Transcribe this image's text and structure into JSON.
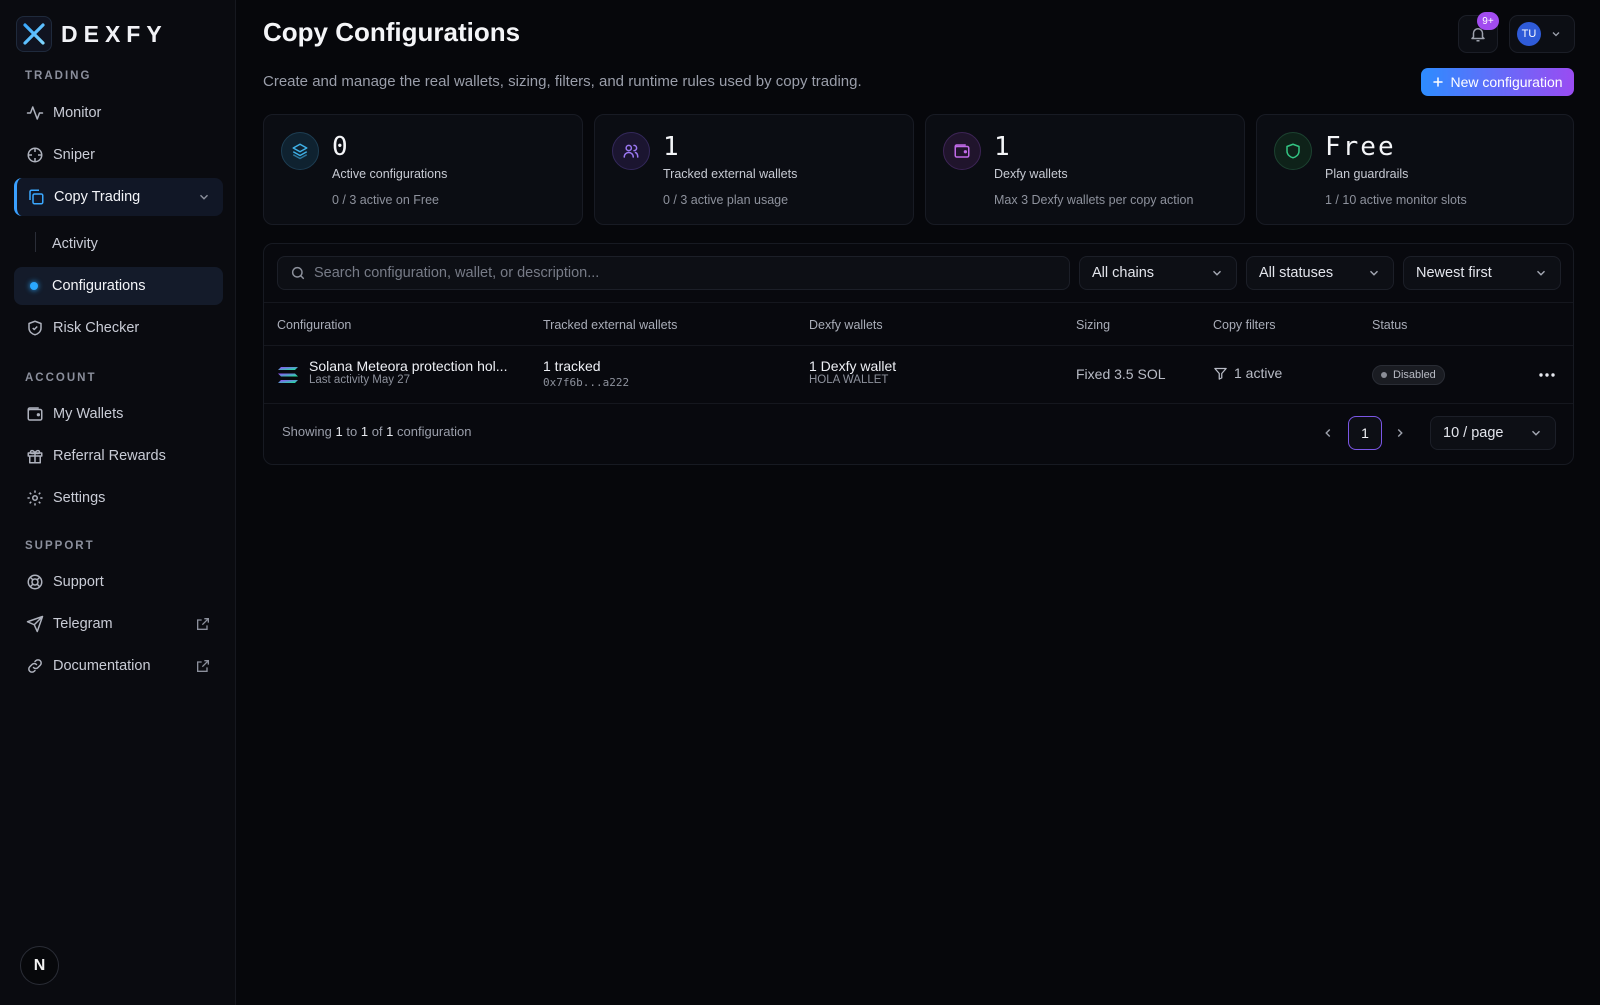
{
  "brand": {
    "name": "DEXFY"
  },
  "sidebar": {
    "trading_label": "TRADING",
    "account_label": "ACCOUNT",
    "support_label": "SUPPORT",
    "monitor": "Monitor",
    "sniper": "Sniper",
    "copy_trading": "Copy Trading",
    "activity": "Activity",
    "configurations": "Configurations",
    "risk_checker": "Risk Checker",
    "my_wallets": "My Wallets",
    "referral_rewards": "Referral Rewards",
    "settings": "Settings",
    "support": "Support",
    "telegram": "Telegram",
    "documentation": "Documentation",
    "bottom_badge": "N"
  },
  "header": {
    "title": "Copy Configurations",
    "subtitle": "Create and manage the real wallets, sizing, filters, and runtime rules used by copy trading.",
    "notifications_badge": "9+",
    "user_initials": "TU",
    "new_button": "New configuration"
  },
  "stats": [
    {
      "value": "0",
      "label": "Active configurations",
      "note": "0 / 3 active on Free",
      "icon": "layers-icon",
      "color": "#2b9cd8"
    },
    {
      "value": "1",
      "label": "Tracked external wallets",
      "note": "0 / 3 active plan usage",
      "icon": "users-icon",
      "color": "#8a5cf0"
    },
    {
      "value": "1",
      "label": "Dexfy wallets",
      "note": "Max 3 Dexfy wallets per copy action",
      "icon": "wallet-icon",
      "color": "#b45ce8"
    },
    {
      "value": "Free",
      "label": "Plan guardrails",
      "note": "1 / 10 active monitor slots",
      "icon": "shield-icon",
      "color": "#2cc080"
    }
  ],
  "filters": {
    "search_placeholder": "Search configuration, wallet, or description...",
    "chain": "All chains",
    "status": "All statuses",
    "sort": "Newest first"
  },
  "table": {
    "columns": [
      "Configuration",
      "Tracked external wallets",
      "Dexfy wallets",
      "Sizing",
      "Copy filters",
      "Status"
    ],
    "rows": [
      {
        "name": "Solana Meteora protection hol...",
        "last_activity": "Last activity May 27",
        "tracked": "1 tracked",
        "tracked_addr": "0x7f6b...a222",
        "dexfy": "1 Dexfy wallet",
        "dexfy_name": "HOLA WALLET",
        "sizing": "Fixed 3.5 SOL",
        "filters": "1 active",
        "status": "Disabled"
      }
    ]
  },
  "pagination": {
    "showing_prefix": "Showing",
    "from": "1",
    "to_word": "to",
    "to": "1",
    "of_word": "of",
    "total": "1",
    "suffix": "configuration",
    "current_page": "1",
    "per_page": "10 / page"
  }
}
